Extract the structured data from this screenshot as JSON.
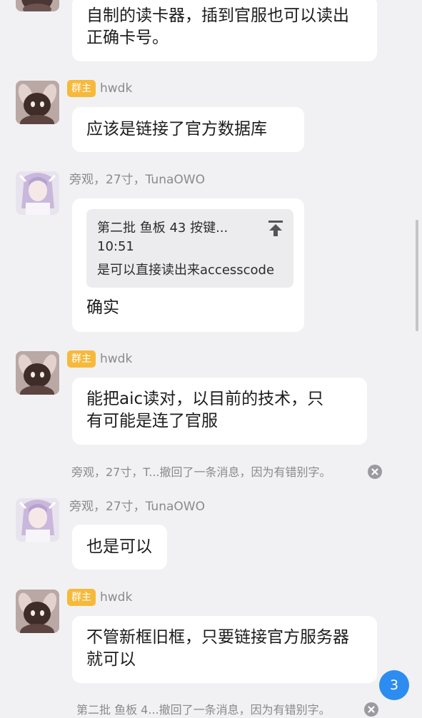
{
  "messages": [
    {
      "lines": [
        "自制的读卡器，插到官服也可以读出",
        "正确卡号。"
      ]
    },
    {
      "badge": "群主",
      "sender": "hwdk",
      "lines": [
        "应该是链接了官方数据库"
      ]
    },
    {
      "sender": "旁观，27寸，TunaOWO",
      "quote": {
        "line1": "第二批 鱼板 43 按键...",
        "time": "10:51",
        "text": "是可以直接读出来accesscode"
      },
      "lines": [
        "确实"
      ]
    },
    {
      "badge": "群主",
      "sender": "hwdk",
      "lines": [
        "能把aic读对，以目前的技术，只",
        "有可能是连了官服"
      ]
    },
    {
      "recall": "旁观，27寸，T...撤回了一条消息，因为有错别字。"
    },
    {
      "sender": "旁观，27寸，TunaOWO",
      "lines": [
        "也是可以"
      ]
    },
    {
      "badge": "群主",
      "sender": "hwdk",
      "lines": [
        "不管新框旧框，只要链接官方服务器",
        "就可以"
      ]
    },
    {
      "recall": "第二批 鱼板 4...撤回了一条消息，因为有错别字。"
    }
  ],
  "unread_count": "3",
  "icons": {
    "pin": "pin-to-top-icon",
    "close": "close-icon",
    "avatar_owner": "avatar-brown-plush",
    "avatar_member": "avatar-anime-girl"
  },
  "colors": {
    "badge": "#f6b93b",
    "unread": "#2d8cf0",
    "background": "#f1f1f4"
  }
}
